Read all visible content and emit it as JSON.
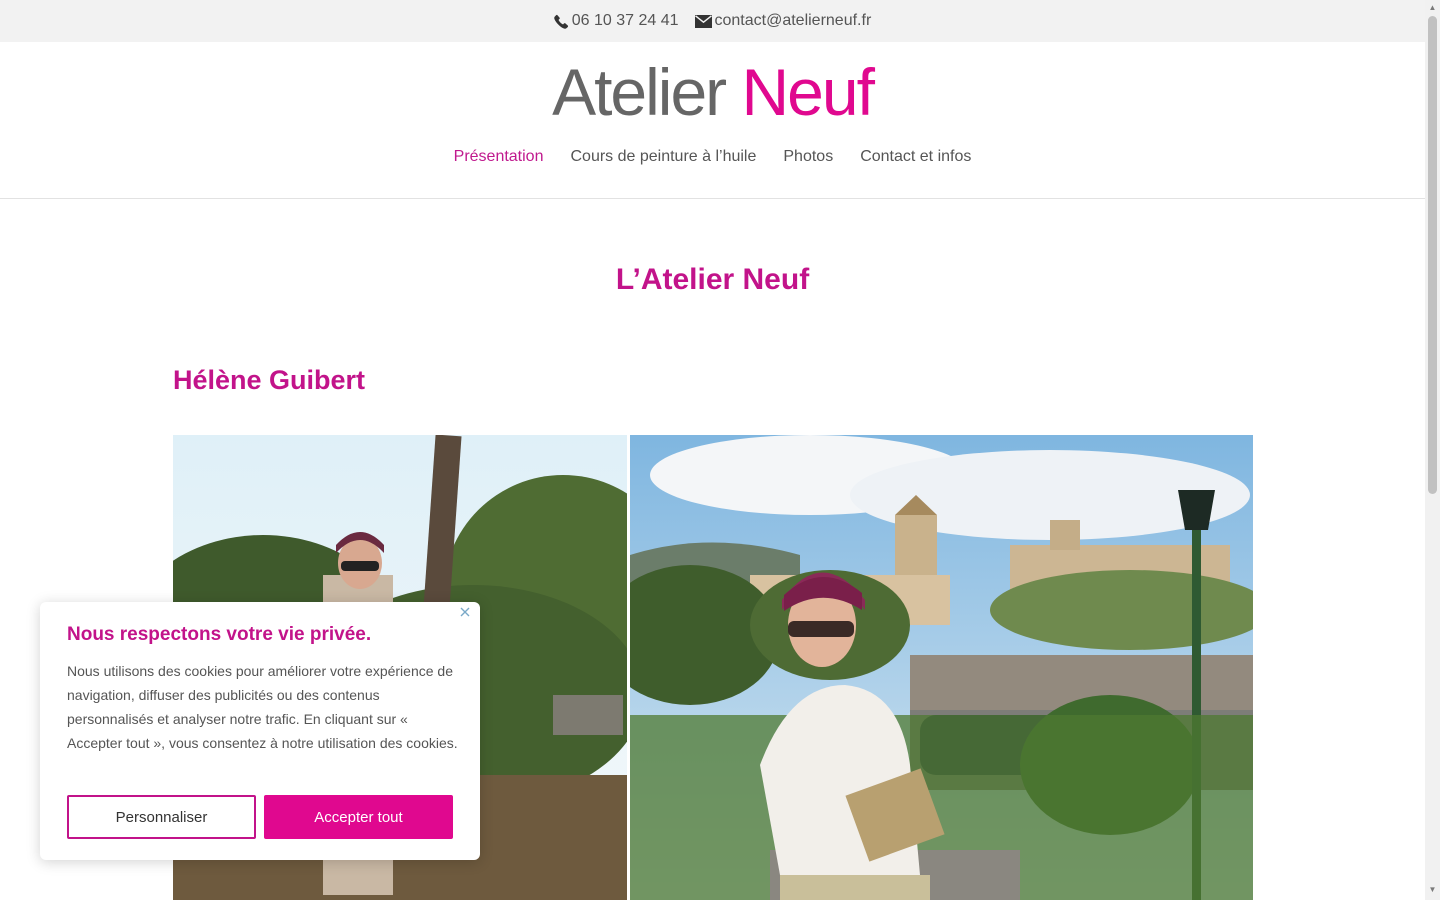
{
  "topbar": {
    "phone": "06 10 37 24 41",
    "email": "contact@atelierneuf.fr"
  },
  "logo": {
    "part1": "Atelier",
    "part2": "Neuf"
  },
  "nav": {
    "items": [
      {
        "label": "Présentation",
        "active": true
      },
      {
        "label": "Cours de peinture à l’huile",
        "active": false
      },
      {
        "label": "Photos",
        "active": false
      },
      {
        "label": "Contact et infos",
        "active": false
      }
    ]
  },
  "main": {
    "title": "L’Atelier Neuf",
    "subtitle": "Hélène Guibert"
  },
  "cookie": {
    "title": "Nous respectons votre vie privée.",
    "text": "Nous utilisons des cookies pour améliorer votre expérience de navigation, diffuser des publicités ou des contenus personnalisés et analyser notre trafic. En cliquant sur « Accepter tout », vous consentez à notre utilisation des cookies.",
    "customize_label": "Personnaliser",
    "accept_label": "Accepter tout"
  },
  "colors": {
    "accent": "#e0088f",
    "heading": "#c2138a",
    "topbar_bg": "#f2f2f2"
  },
  "icons": [
    "phone-icon",
    "mail-icon",
    "close-icon"
  ]
}
